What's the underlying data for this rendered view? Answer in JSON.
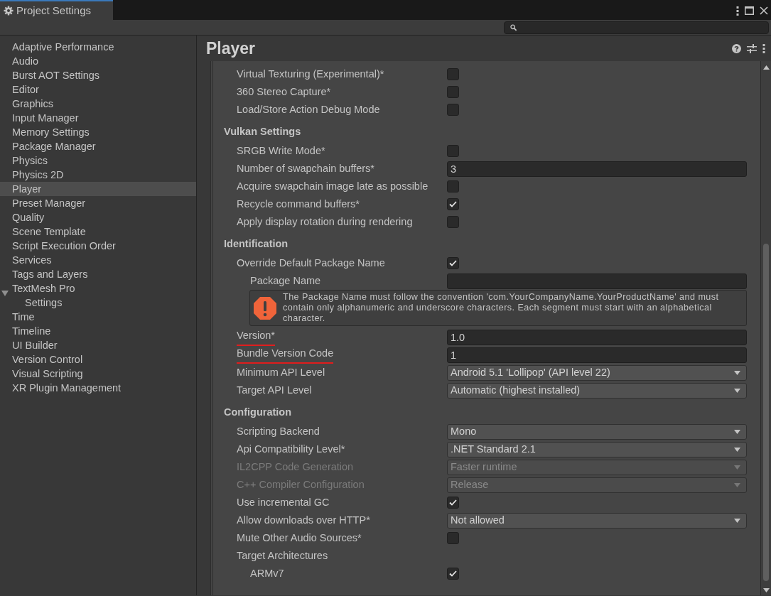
{
  "window": {
    "title": "Project Settings"
  },
  "sidebar": {
    "items": [
      {
        "label": "Adaptive Performance",
        "selected": false
      },
      {
        "label": "Audio",
        "selected": false
      },
      {
        "label": "Burst AOT Settings",
        "selected": false
      },
      {
        "label": "Editor",
        "selected": false
      },
      {
        "label": "Graphics",
        "selected": false
      },
      {
        "label": "Input Manager",
        "selected": false
      },
      {
        "label": "Memory Settings",
        "selected": false
      },
      {
        "label": "Package Manager",
        "selected": false
      },
      {
        "label": "Physics",
        "selected": false
      },
      {
        "label": "Physics 2D",
        "selected": false
      },
      {
        "label": "Player",
        "selected": true
      },
      {
        "label": "Preset Manager",
        "selected": false
      },
      {
        "label": "Quality",
        "selected": false
      },
      {
        "label": "Scene Template",
        "selected": false
      },
      {
        "label": "Script Execution Order",
        "selected": false
      },
      {
        "label": "Services",
        "selected": false
      },
      {
        "label": "Tags and Layers",
        "selected": false
      },
      {
        "label": "TextMesh Pro",
        "selected": false,
        "expanded": true,
        "children": [
          {
            "label": "Settings",
            "selected": false
          }
        ]
      },
      {
        "label": "Time",
        "selected": false
      },
      {
        "label": "Timeline",
        "selected": false
      },
      {
        "label": "UI Builder",
        "selected": false
      },
      {
        "label": "Version Control",
        "selected": false
      },
      {
        "label": "Visual Scripting",
        "selected": false
      },
      {
        "label": "XR Plugin Management",
        "selected": false
      }
    ]
  },
  "panel": {
    "title": "Player",
    "sections": [
      {
        "rows": [
          {
            "kind": "checkbox",
            "label": "Virtual Texturing (Experimental)*",
            "checked": false,
            "disabled": false
          },
          {
            "kind": "checkbox",
            "label": "360 Stereo Capture*",
            "checked": false,
            "disabled": false
          },
          {
            "kind": "checkbox",
            "label": "Load/Store Action Debug Mode",
            "checked": false,
            "disabled": false
          }
        ]
      },
      {
        "title": "Vulkan Settings",
        "rows": [
          {
            "kind": "checkbox",
            "label": "SRGB Write Mode*",
            "checked": false,
            "disabled": false
          },
          {
            "kind": "text",
            "label": "Number of swapchain buffers*",
            "value": "3",
            "disabled": false
          },
          {
            "kind": "checkbox",
            "label": "Acquire swapchain image late as possible",
            "checked": false,
            "disabled": false
          },
          {
            "kind": "checkbox",
            "label": "Recycle command buffers*",
            "checked": true,
            "disabled": false
          },
          {
            "kind": "checkbox",
            "label": "Apply display rotation during rendering",
            "checked": false,
            "disabled": false
          }
        ]
      },
      {
        "title": "Identification",
        "rows": [
          {
            "kind": "checkbox",
            "label": "Override Default Package Name",
            "checked": true,
            "disabled": false,
            "children": [
              {
                "kind": "text",
                "label": "Package Name",
                "disabled": false
              },
              {
                "kind": "helpbox",
                "text": "The Package Name must follow the convention 'com.YourCompanyName.YourProductName' and must contain only alphanumeric and underscore characters. Each segment must start with an alphabetical character."
              }
            ]
          },
          {
            "kind": "text",
            "label": "Version*",
            "value": "1.0",
            "disabled": false,
            "underlined": true
          },
          {
            "kind": "text",
            "label": "Bundle Version Code",
            "value": "1",
            "disabled": false,
            "underlined": true
          },
          {
            "kind": "dropdown",
            "label": "Minimum API Level",
            "value": "Android 5.1 'Lollipop' (API level 22)",
            "disabled": false
          },
          {
            "kind": "dropdown",
            "label": "Target API Level",
            "value": "Automatic (highest installed)",
            "disabled": false
          }
        ]
      },
      {
        "title": "Configuration",
        "rows": [
          {
            "kind": "dropdown",
            "label": "Scripting Backend",
            "value": "Mono",
            "disabled": false
          },
          {
            "kind": "dropdown",
            "label": "Api Compatibility Level*",
            "value": ".NET Standard 2.1",
            "disabled": false
          },
          {
            "kind": "dropdown",
            "label": "IL2CPP Code Generation",
            "value": "Faster runtime",
            "disabled": true
          },
          {
            "kind": "dropdown",
            "label": "C++ Compiler Configuration",
            "value": "Release",
            "disabled": true
          },
          {
            "kind": "checkbox",
            "label": "Use incremental GC",
            "checked": true,
            "disabled": false
          },
          {
            "kind": "dropdown",
            "label": "Allow downloads over HTTP*",
            "value": "Not allowed",
            "disabled": false
          },
          {
            "kind": "checkbox",
            "label": "Mute Other Audio Sources*",
            "checked": false,
            "disabled": false
          },
          {
            "kind": "label",
            "label": "Target Architectures",
            "children": [
              {
                "kind": "checkbox",
                "label": "ARMv7",
                "checked": true,
                "disabled": false
              }
            ]
          }
        ]
      }
    ]
  }
}
